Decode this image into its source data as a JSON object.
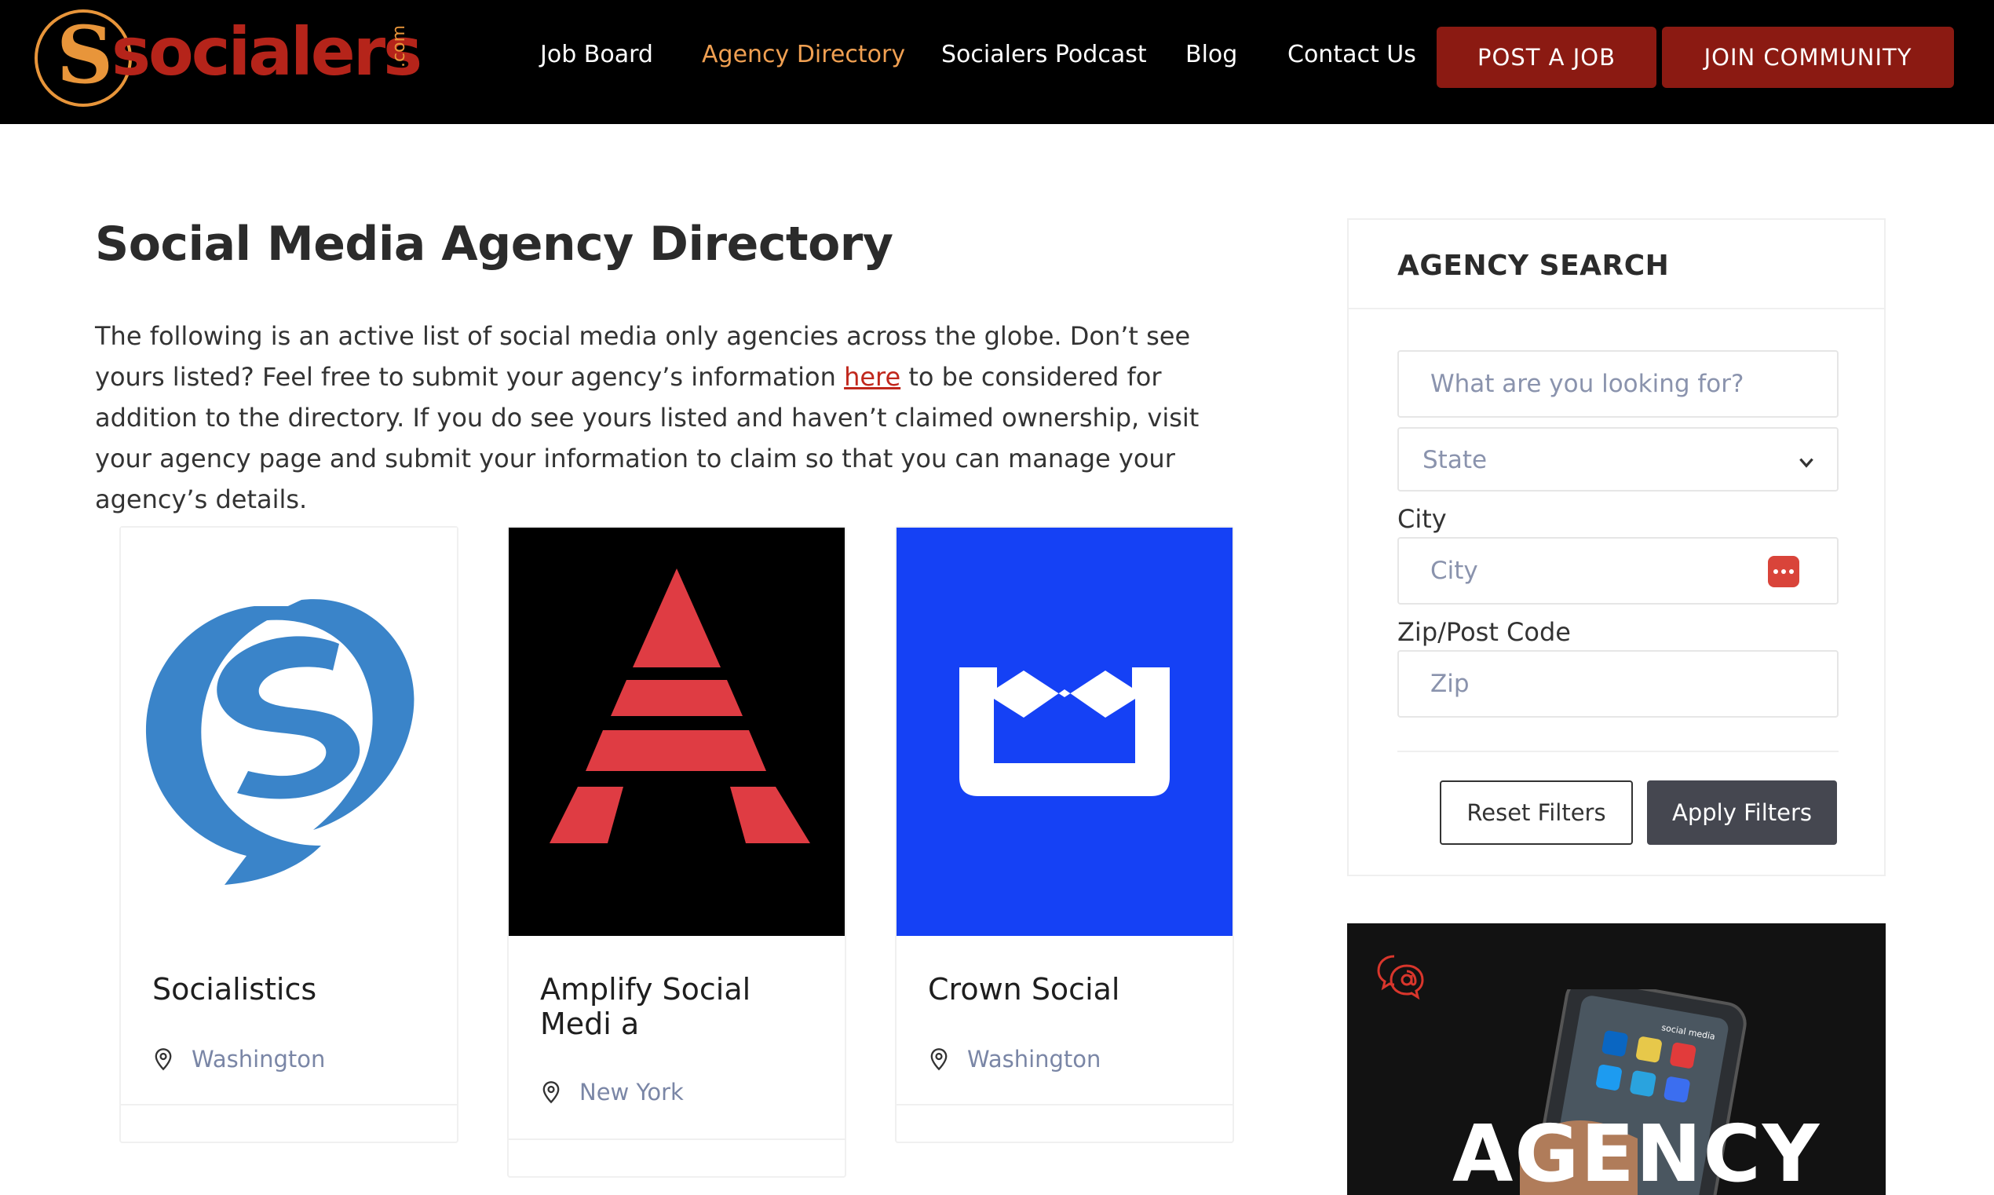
{
  "brand": {
    "logo_mark": "S",
    "wordmark": "socialers",
    "tld": ".com",
    "accent_color": "#e8953a",
    "wordmark_color": "#b5241a"
  },
  "nav": {
    "items": [
      {
        "label": "Job Board",
        "active": false
      },
      {
        "label": "Agency Directory",
        "active": true
      },
      {
        "label": "Socialers Podcast",
        "active": false
      },
      {
        "label": "Blog",
        "active": false
      },
      {
        "label": "Contact Us",
        "active": false
      }
    ],
    "post_job_label": "POST A JOB",
    "join_label": "JOIN COMMUNITY",
    "button_color": "#8b1a12",
    "active_color": "#f0a052"
  },
  "main": {
    "title": "Social Media Agency Directory",
    "intro_before": "The following is an active list of social media only agencies across the globe. Don’t see yours listed? Feel free to submit your agency’s information ",
    "intro_link": "here",
    "intro_after": " to be considered for addition to the directory. If you do see yours listed and haven’t claimed ownership, visit your agency page and submit your information to claim so that you can manage your agency’s details."
  },
  "agencies": [
    {
      "name": "Socialistics",
      "location": "Washington",
      "logo": "speech-bubble-s-logo",
      "logo_bg": "#ffffff",
      "logo_color": "#3a84c9"
    },
    {
      "name": "Amplify Social Medi a",
      "location": "New York",
      "logo": "striped-a-logo",
      "logo_bg": "#000000",
      "logo_color": "#df3c43"
    },
    {
      "name": "Crown Social",
      "location": "Washington",
      "logo": "crown-logo",
      "logo_bg": "#1541f5",
      "logo_color": "#ffffff"
    }
  ],
  "search": {
    "title": "AGENCY SEARCH",
    "keyword_placeholder": "What are you looking for?",
    "state_value": "State",
    "city_label": "City",
    "city_placeholder": "City",
    "zip_label": "Zip/Post Code",
    "zip_placeholder": "Zip",
    "reset_label": "Reset Filters",
    "apply_label": "Apply Filters"
  },
  "promo": {
    "headline": "AGENCY",
    "phone_caption": "social media",
    "icon": "chat-at-icon"
  }
}
